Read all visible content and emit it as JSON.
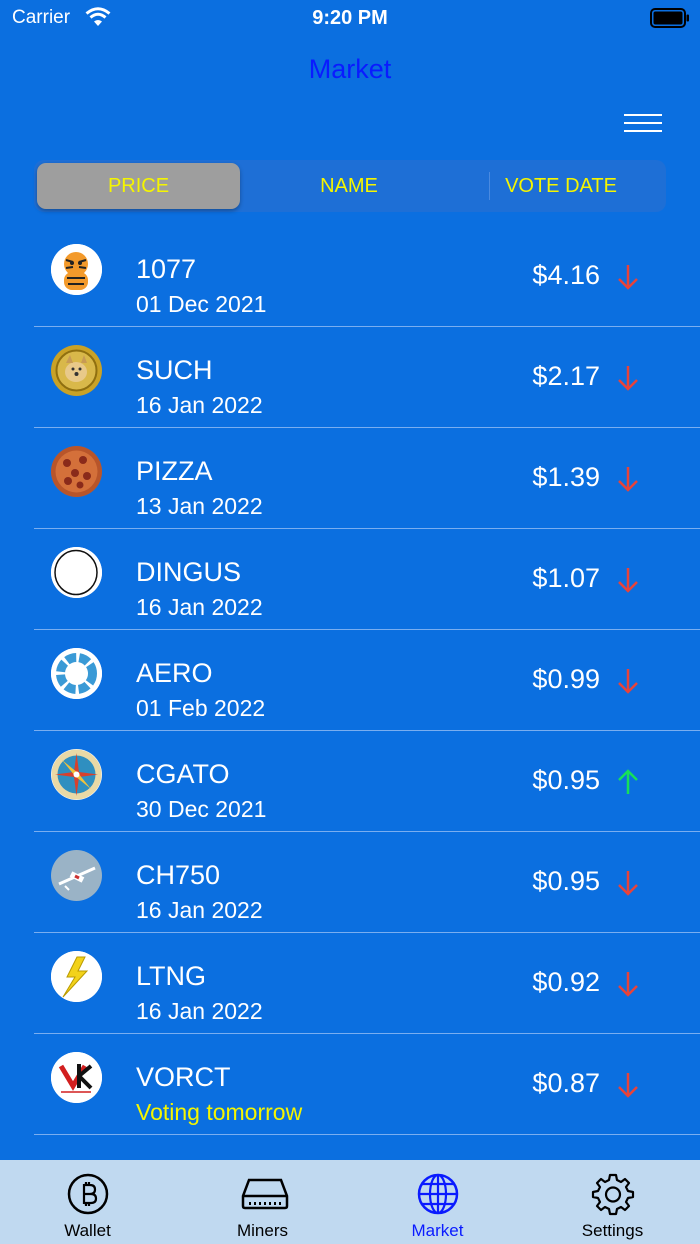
{
  "status_bar": {
    "carrier": "Carrier",
    "time": "9:20 PM"
  },
  "nav": {
    "title": "Market"
  },
  "segments": [
    {
      "label": "PRICE",
      "active": true
    },
    {
      "label": "NAME",
      "active": false
    },
    {
      "label": "VOTE DATE",
      "active": false
    }
  ],
  "coins": [
    {
      "symbol": "1077",
      "date": "01 Dec 2021",
      "price": "$4.16",
      "trend": "down",
      "logo": "tiger-logo"
    },
    {
      "symbol": "SUCH",
      "date": "16 Jan 2022",
      "price": "$2.17",
      "trend": "down",
      "logo": "doge-coin-logo"
    },
    {
      "symbol": "PIZZA",
      "date": "13 Jan 2022",
      "price": "$1.39",
      "trend": "down",
      "logo": "pizza-logo"
    },
    {
      "symbol": "DINGUS",
      "date": "16 Jan 2022",
      "price": "$1.07",
      "trend": "down",
      "logo": "white-circle-logo"
    },
    {
      "symbol": "AERO",
      "date": "01 Feb 2022",
      "price": "$0.99",
      "trend": "down",
      "logo": "aero-ring-logo"
    },
    {
      "symbol": "CGATO",
      "date": "30 Dec 2021",
      "price": "$0.95",
      "trend": "up",
      "logo": "compass-logo"
    },
    {
      "symbol": "CH750",
      "date": "16 Jan 2022",
      "price": "$0.95",
      "trend": "down",
      "logo": "airplane-logo"
    },
    {
      "symbol": "LTNG",
      "date": "16 Jan 2022",
      "price": "$0.92",
      "trend": "down",
      "logo": "lightning-logo"
    },
    {
      "symbol": "VORCT",
      "date": "Voting tomorrow",
      "price": "$0.87",
      "trend": "down",
      "logo": "vorct-logo"
    }
  ],
  "tabs": [
    {
      "label": "Wallet",
      "icon": "bitcoin-icon",
      "active": false
    },
    {
      "label": "Miners",
      "icon": "drive-icon",
      "active": false
    },
    {
      "label": "Market",
      "icon": "globe-icon",
      "active": true
    },
    {
      "label": "Settings",
      "icon": "gear-icon",
      "active": false
    }
  ],
  "colors": {
    "background": "#0b6fe0",
    "title": "#0a1bff",
    "segment_text": "#f5f500",
    "down_arrow": "#e8433a",
    "up_arrow": "#16e05a",
    "tab_bar": "#c0d9f0"
  }
}
